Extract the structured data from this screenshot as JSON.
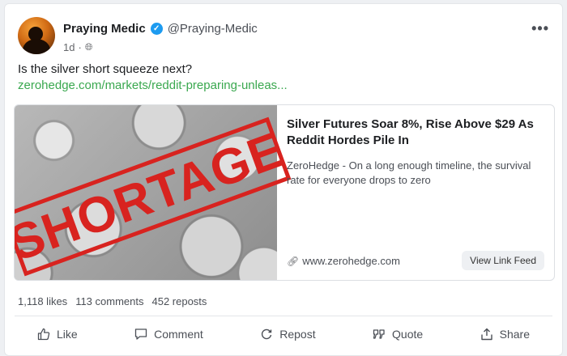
{
  "post": {
    "author": {
      "name": "Praying Medic",
      "handle": "@Praying-Medic"
    },
    "time": "1d",
    "separator": "·",
    "text": "Is the silver short squeeze next?",
    "link_text": "zerohedge.com/markets/reddit-preparing-unleas..."
  },
  "link_card": {
    "image_stamp_text": "SHORTAGE",
    "title": "Silver Futures Soar 8%, Rise Above $29 As Reddit Hordes Pile In",
    "description": "ZeroHedge - On a long enough timeline, the survival rate for everyone drops to zero",
    "domain": "www.zerohedge.com",
    "button_label": "View Link Feed"
  },
  "stats": {
    "likes": "1,118 likes",
    "comments": "113 comments",
    "reposts": "452 reposts"
  },
  "actions": {
    "like": "Like",
    "comment": "Comment",
    "repost": "Repost",
    "quote": "Quote",
    "share": "Share"
  },
  "icons": {
    "verified": "verified-check-icon",
    "visibility": "globe-icon",
    "more": "more-options-icon",
    "link": "chain-link-icon",
    "like": "thumbs-up-icon",
    "comment": "comment-icon",
    "repost": "repost-icon",
    "quote": "quote-icon",
    "share": "share-icon"
  },
  "colors": {
    "link": "#3aa84f",
    "verified": "#1d9bf0",
    "stamp": "#d8231f"
  }
}
